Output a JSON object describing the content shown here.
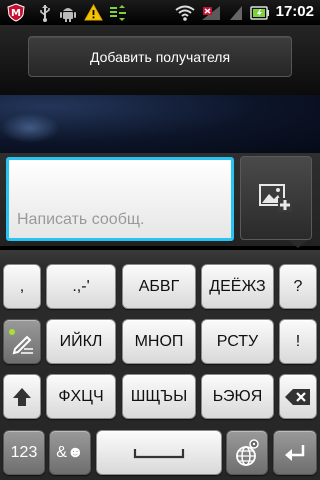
{
  "status_bar": {
    "icons": [
      "mcafee-icon",
      "usb-icon",
      "android-debug-icon",
      "warning-icon",
      "sync-icon",
      "wifi-icon",
      "no-signal-icon",
      "battery-icon"
    ],
    "time": "17:02"
  },
  "header": {
    "add_recipient_label": "Добавить получателя"
  },
  "compose": {
    "placeholder": "Написать сообщ.",
    "attach_icon": "image-add-icon",
    "accent_color": "#29c3f1"
  },
  "keyboard": {
    "row1": [
      ",",
      ".,-'",
      "АБВГ",
      "ДЕЁЖЗ",
      "?"
    ],
    "row2": [
      "ИЙКЛ",
      "МНОП",
      "РСТУ",
      "!"
    ],
    "row3": [
      "ФХЦЧ",
      "ШЩЪЫ",
      "ЬЭЮЯ"
    ],
    "row4": [
      "123",
      "&☻"
    ]
  }
}
